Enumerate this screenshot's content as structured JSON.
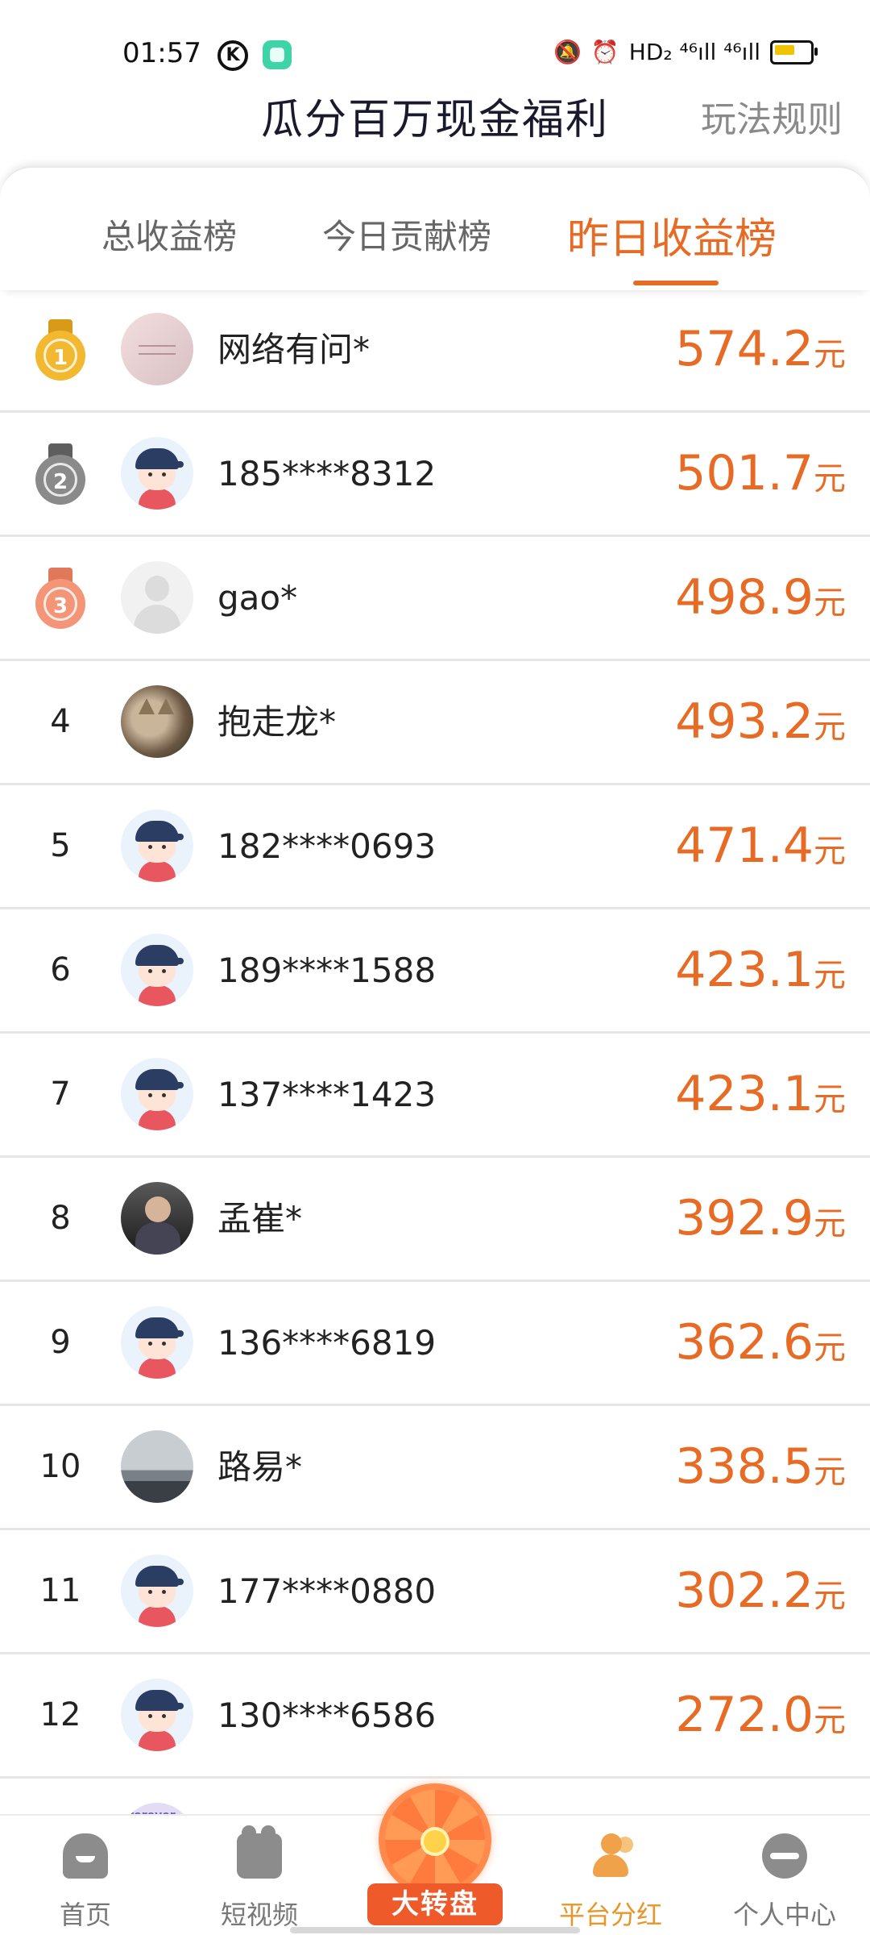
{
  "status_bar": {
    "time": "01:57",
    "k_icon": "K",
    "network": "HD₂ ⁴⁶ıll ⁴⁶ıll",
    "icons": [
      "mute-icon",
      "alarm-icon",
      "hd-icon",
      "signal-icon",
      "signal-icon",
      "battery-icon"
    ]
  },
  "header": {
    "title": "瓜分百万现金福利",
    "rules_link": "玩法规则"
  },
  "tabs": [
    {
      "label": "总收益榜",
      "active": false
    },
    {
      "label": "今日贡献榜",
      "active": false
    },
    {
      "label": "昨日收益榜",
      "active": true
    }
  ],
  "unit": "元",
  "leaderboard": [
    {
      "rank": "1",
      "name": "网络有问*",
      "amount": "574.2"
    },
    {
      "rank": "2",
      "name": "185****8312",
      "amount": "501.7"
    },
    {
      "rank": "3",
      "name": "gao*",
      "amount": "498.9"
    },
    {
      "rank": "4",
      "name": "抱走龙*",
      "amount": "493.2"
    },
    {
      "rank": "5",
      "name": "182****0693",
      "amount": "471.4"
    },
    {
      "rank": "6",
      "name": "189****1588",
      "amount": "423.1"
    },
    {
      "rank": "7",
      "name": "137****1423",
      "amount": "423.1"
    },
    {
      "rank": "8",
      "name": "孟崔*",
      "amount": "392.9"
    },
    {
      "rank": "9",
      "name": "136****6819",
      "amount": "362.6"
    },
    {
      "rank": "10",
      "name": "路易*",
      "amount": "338.5"
    },
    {
      "rank": "11",
      "name": "177****0880",
      "amount": "302.2"
    },
    {
      "rank": "12",
      "name": "130****6586",
      "amount": "272.0"
    }
  ],
  "partial_avatar_text": "forever",
  "bottom_nav": [
    {
      "label": "首页",
      "icon": "home-icon",
      "active": false
    },
    {
      "label": "短视频",
      "icon": "video-icon",
      "active": false
    },
    {
      "label": "大转盘",
      "icon": "wheel-icon",
      "active": false
    },
    {
      "label": "平台分红",
      "icon": "people-icon",
      "active": true
    },
    {
      "label": "个人中心",
      "icon": "user-icon",
      "active": false
    }
  ],
  "colors": {
    "accent": "#e86b25",
    "active_nav": "#e8962a",
    "gold": "#f2b82f",
    "silver": "#8a8a8a",
    "bronze": "#f59577"
  }
}
